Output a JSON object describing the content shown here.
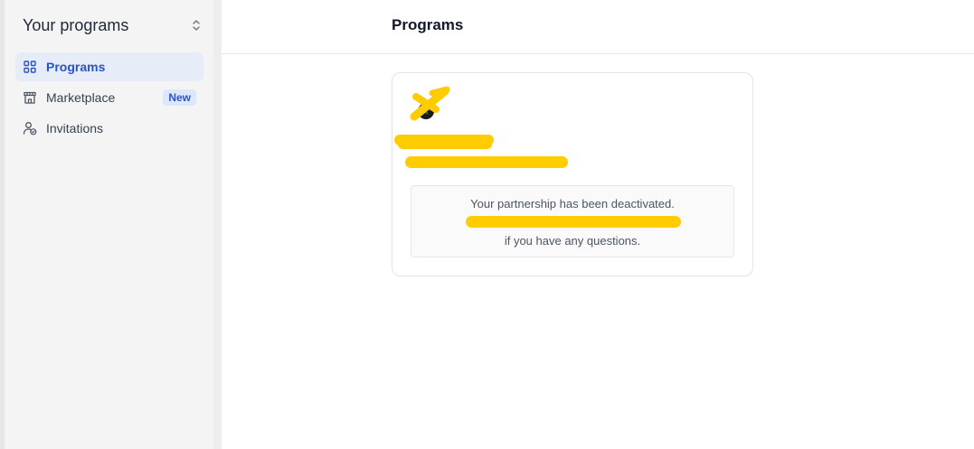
{
  "sidebar": {
    "title": "Your programs",
    "switcher_icon": "chevron-up-down-icon",
    "items": [
      {
        "label": "Programs",
        "icon": "grid-icon",
        "active": true,
        "badge": ""
      },
      {
        "label": "Marketplace",
        "icon": "storefront-icon",
        "active": false,
        "badge": "New"
      },
      {
        "label": "Invitations",
        "icon": "user-check-icon",
        "active": false,
        "badge": ""
      }
    ]
  },
  "header": {
    "title": "Programs"
  },
  "program_card": {
    "notice": {
      "line1": "Your partnership has been deactivated.",
      "line2": "if you have any questions."
    }
  },
  "colors": {
    "accent": "#2a54c9",
    "active_bg": "#e6ecf8",
    "redaction": "#ffcc00"
  }
}
